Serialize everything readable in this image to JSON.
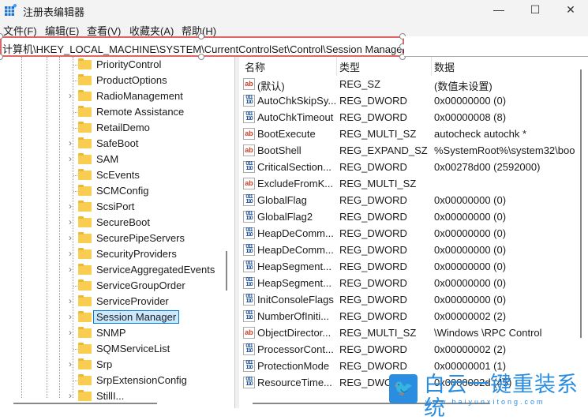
{
  "window": {
    "title": "注册表编辑器",
    "minimize": "—",
    "maximize": "☐",
    "close": "✕"
  },
  "menu": [
    "文件(F)",
    "编辑(E)",
    "查看(V)",
    "收藏夹(A)",
    "帮助(H)"
  ],
  "address": "计算机\\HKEY_LOCAL_MACHINE\\SYSTEM\\CurrentControlSet\\Control\\Session Manager",
  "tree": [
    {
      "label": "PriorityControl",
      "expandable": false
    },
    {
      "label": "ProductOptions",
      "expandable": false
    },
    {
      "label": "RadioManagement",
      "expandable": true
    },
    {
      "label": "Remote Assistance",
      "expandable": false
    },
    {
      "label": "RetailDemo",
      "expandable": false
    },
    {
      "label": "SafeBoot",
      "expandable": true
    },
    {
      "label": "SAM",
      "expandable": true
    },
    {
      "label": "ScEvents",
      "expandable": false
    },
    {
      "label": "SCMConfig",
      "expandable": false
    },
    {
      "label": "ScsiPort",
      "expandable": true
    },
    {
      "label": "SecureBoot",
      "expandable": true
    },
    {
      "label": "SecurePipeServers",
      "expandable": true
    },
    {
      "label": "SecurityProviders",
      "expandable": true
    },
    {
      "label": "ServiceAggregatedEvents",
      "expandable": true
    },
    {
      "label": "ServiceGroupOrder",
      "expandable": false
    },
    {
      "label": "ServiceProvider",
      "expandable": true
    },
    {
      "label": "Session Manager",
      "expandable": true,
      "selected": true
    },
    {
      "label": "SNMP",
      "expandable": true
    },
    {
      "label": "SQMServiceList",
      "expandable": false
    },
    {
      "label": "Srp",
      "expandable": true
    },
    {
      "label": "SrpExtensionConfig",
      "expandable": false
    },
    {
      "label": "StillI...",
      "expandable": true
    }
  ],
  "columns": {
    "name": "名称",
    "type": "类型",
    "data": "数据"
  },
  "values": [
    {
      "name": "(默认)",
      "type": "REG_SZ",
      "data": "(数值未设置)",
      "icon": "string"
    },
    {
      "name": "AutoChkSkipSy...",
      "type": "REG_DWORD",
      "data": "0x00000000 (0)",
      "icon": "binary"
    },
    {
      "name": "AutoChkTimeout",
      "type": "REG_DWORD",
      "data": "0x00000008 (8)",
      "icon": "binary"
    },
    {
      "name": "BootExecute",
      "type": "REG_MULTI_SZ",
      "data": "autocheck autochk *",
      "icon": "string"
    },
    {
      "name": "BootShell",
      "type": "REG_EXPAND_SZ",
      "data": "%SystemRoot%\\system32\\boo",
      "icon": "string"
    },
    {
      "name": "CriticalSection...",
      "type": "REG_DWORD",
      "data": "0x00278d00 (2592000)",
      "icon": "binary"
    },
    {
      "name": "ExcludeFromK...",
      "type": "REG_MULTI_SZ",
      "data": "",
      "icon": "string"
    },
    {
      "name": "GlobalFlag",
      "type": "REG_DWORD",
      "data": "0x00000000 (0)",
      "icon": "binary"
    },
    {
      "name": "GlobalFlag2",
      "type": "REG_DWORD",
      "data": "0x00000000 (0)",
      "icon": "binary"
    },
    {
      "name": "HeapDeComm...",
      "type": "REG_DWORD",
      "data": "0x00000000 (0)",
      "icon": "binary"
    },
    {
      "name": "HeapDeComm...",
      "type": "REG_DWORD",
      "data": "0x00000000 (0)",
      "icon": "binary"
    },
    {
      "name": "HeapSegment...",
      "type": "REG_DWORD",
      "data": "0x00000000 (0)",
      "icon": "binary"
    },
    {
      "name": "HeapSegment...",
      "type": "REG_DWORD",
      "data": "0x00000000 (0)",
      "icon": "binary"
    },
    {
      "name": "InitConsoleFlags",
      "type": "REG_DWORD",
      "data": "0x00000000 (0)",
      "icon": "binary"
    },
    {
      "name": "NumberOfIniti...",
      "type": "REG_DWORD",
      "data": "0x00000002 (2)",
      "icon": "binary"
    },
    {
      "name": "ObjectDirector...",
      "type": "REG_MULTI_SZ",
      "data": "\\Windows \\RPC Control",
      "icon": "string"
    },
    {
      "name": "ProcessorCont...",
      "type": "REG_DWORD",
      "data": "0x00000002 (2)",
      "icon": "binary"
    },
    {
      "name": "ProtectionMode",
      "type": "REG_DWORD",
      "data": "0x00000001 (1)",
      "icon": "binary"
    },
    {
      "name": "ResourceTime...",
      "type": "REG_DWORD",
      "data": "0x0000002d (45)",
      "icon": "binary"
    }
  ],
  "watermark": {
    "text": "白云一键重装系统",
    "url": "www.baiyunxitong.com"
  }
}
